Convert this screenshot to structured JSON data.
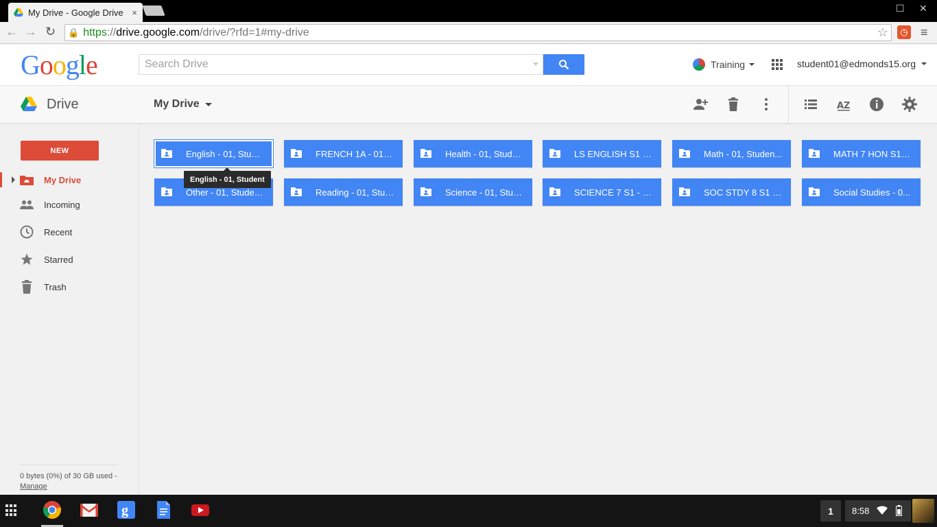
{
  "browser": {
    "tab_title": "My Drive - Google Drive",
    "tab_close": "×",
    "url_https": "https",
    "url_sep": "://",
    "url_host": "drive.google.com",
    "url_path": "/drive/?rfd=1#my-drive"
  },
  "google_header": {
    "search_placeholder": "Search Drive",
    "org_name": "Training",
    "account": "student01@edmonds15.org"
  },
  "drive_header": {
    "product": "Drive",
    "location": "My Drive"
  },
  "sidebar": {
    "new_label": "NEW",
    "items": [
      {
        "label": "My Drive",
        "icon": "my-drive-icon",
        "active": true
      },
      {
        "label": "Incoming",
        "icon": "people-icon"
      },
      {
        "label": "Recent",
        "icon": "clock-icon"
      },
      {
        "label": "Starred",
        "icon": "star-icon"
      },
      {
        "label": "Trash",
        "icon": "trash-icon"
      }
    ],
    "storage_text": "0 bytes (0%) of 30 GB used -",
    "manage_label": "Manage"
  },
  "folders": [
    {
      "label": "English - 01, Stud...",
      "selected": true
    },
    {
      "label": "FRENCH 1A - 01, ..."
    },
    {
      "label": "Health - 01, Stude..."
    },
    {
      "label": "LS ENGLISH S1 - ..."
    },
    {
      "label": "Math - 01, Studen..."
    },
    {
      "label": "MATH 7 HON S1 - ..."
    },
    {
      "label": "Other - 01, Studen..."
    },
    {
      "label": "Reading - 01, Stud..."
    },
    {
      "label": "Science - 01, Stud..."
    },
    {
      "label": "SCIENCE 7 S1 - 0..."
    },
    {
      "label": "SOC STDY 8 S1 - ..."
    },
    {
      "label": "Social Studies - 0..."
    }
  ],
  "tooltip": "English - 01, Student",
  "shelf": {
    "notification_count": "1",
    "clock": "8:58"
  },
  "colors": {
    "folder_blue": "#4285f4",
    "new_red": "#dd4b39"
  }
}
